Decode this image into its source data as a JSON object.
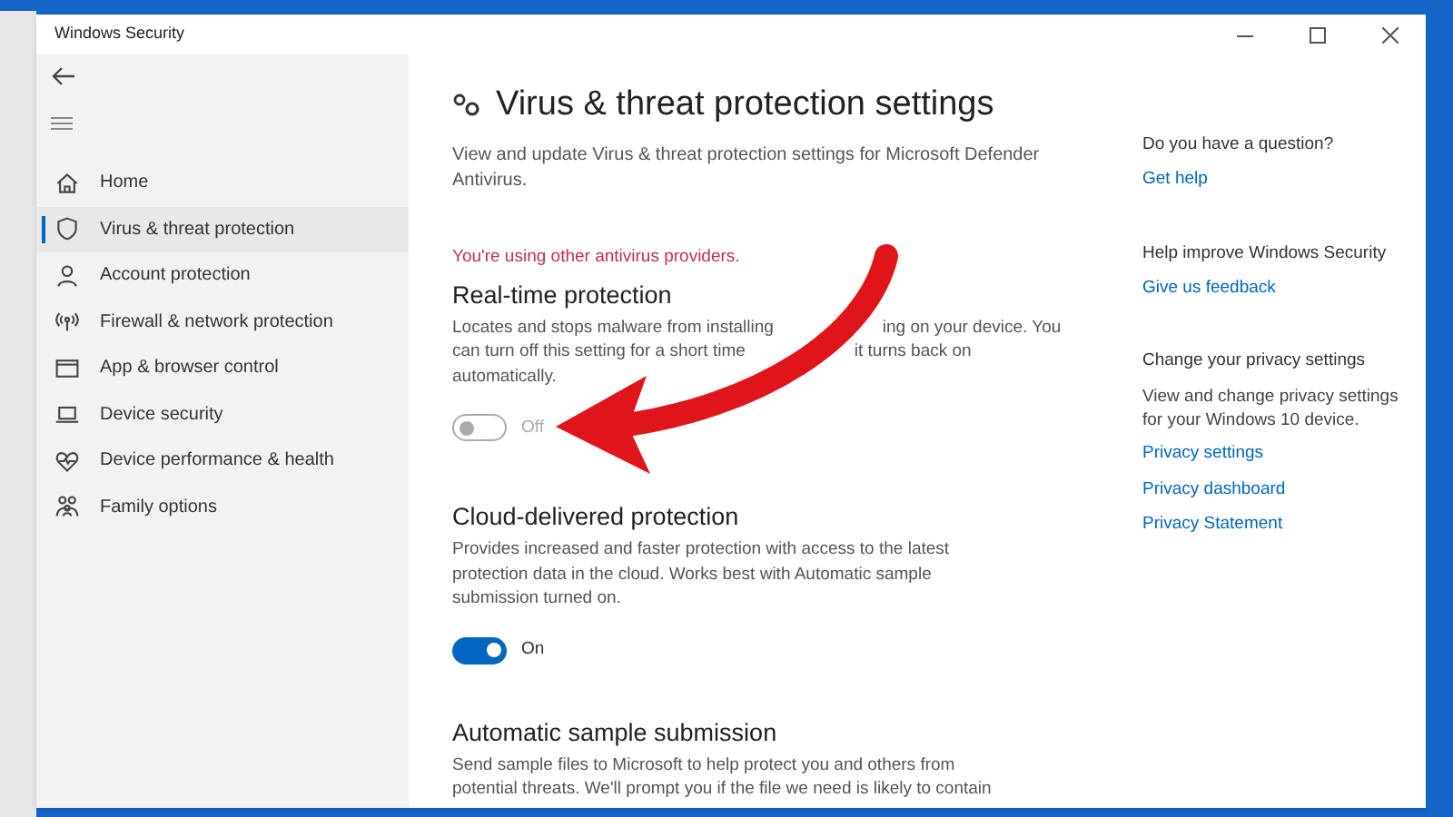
{
  "window": {
    "title": "Windows Security"
  },
  "sidebar": {
    "items": [
      {
        "label": "Home",
        "selected": false
      },
      {
        "label": "Virus & threat protection",
        "selected": true
      },
      {
        "label": "Account protection",
        "selected": false
      },
      {
        "label": "Firewall & network protection",
        "selected": false
      },
      {
        "label": "App & browser control",
        "selected": false
      },
      {
        "label": "Device security",
        "selected": false
      },
      {
        "label": "Device performance & health",
        "selected": false
      },
      {
        "label": "Family options",
        "selected": false
      }
    ]
  },
  "page": {
    "title": "Virus & threat protection settings",
    "description": "View and update Virus & threat protection settings for Microsoft Defender Antivirus.",
    "warning": "You're using other antivirus providers.",
    "sections": [
      {
        "title": "Real-time protection",
        "description_lines": [
          [
            "Locates and stops malware from installing",
            "ing on your device. You"
          ],
          [
            "can turn off this setting for a short time",
            "it turns back on"
          ],
          [
            "automatically."
          ]
        ],
        "on": false,
        "state_label": "Off"
      },
      {
        "title": "Cloud-delivered protection",
        "description_lines": [
          [
            "Provides increased and faster protection with access to the latest"
          ],
          [
            "protection data in the cloud. Works best with Automatic sample"
          ],
          [
            "submission turned on."
          ]
        ],
        "on": true,
        "state_label": "On"
      },
      {
        "title": "Automatic sample submission",
        "description_lines": [
          [
            "Send sample files to Microsoft to help protect you and others from"
          ],
          [
            "potential threats. We'll prompt you if the file we need is likely to contain"
          ]
        ]
      }
    ]
  },
  "aside": [
    {
      "heading": "Do you have a question?",
      "links": [
        "Get help"
      ]
    },
    {
      "heading": "Help improve Windows Security",
      "links": [
        "Give us feedback"
      ]
    },
    {
      "heading": "Change your privacy settings",
      "text": "View and change privacy settings for your Windows 10 device.",
      "links": [
        "Privacy settings",
        "Privacy dashboard",
        "Privacy Statement"
      ]
    }
  ]
}
